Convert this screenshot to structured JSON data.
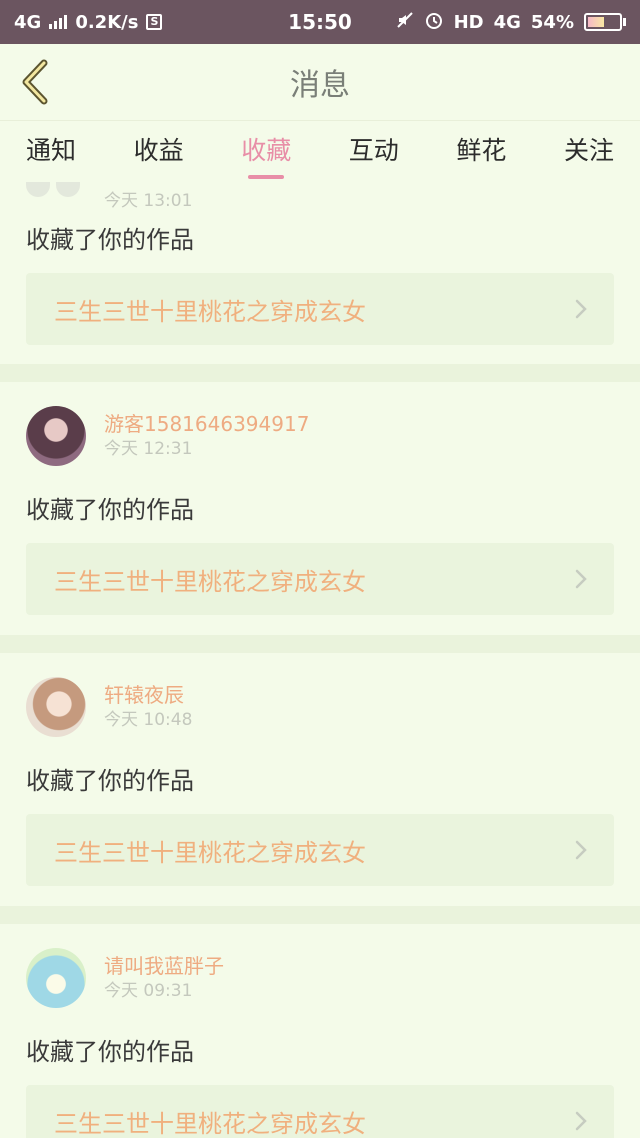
{
  "status_bar": {
    "network": "4G",
    "speed": "0.2K/s",
    "s_icon": "S",
    "time": "15:50",
    "hd": "HD",
    "net_right": "4G",
    "battery": "54%"
  },
  "header": {
    "title": "消息"
  },
  "tabs": [
    {
      "label": "通知"
    },
    {
      "label": "收益"
    },
    {
      "label": "收藏",
      "active": true
    },
    {
      "label": "互动"
    },
    {
      "label": "鲜花"
    },
    {
      "label": "关注"
    }
  ],
  "messages": [
    {
      "username": "",
      "time": "今天 13:01",
      "action": "收藏了你的作品",
      "work_title": "三生三世十里桃花之穿成玄女"
    },
    {
      "username": "游客1581646394917",
      "time": "今天 12:31",
      "action": "收藏了你的作品",
      "work_title": "三生三世十里桃花之穿成玄女"
    },
    {
      "username": "轩辕夜辰",
      "time": "今天 10:48",
      "action": "收藏了你的作品",
      "work_title": "三生三世十里桃花之穿成玄女"
    },
    {
      "username": "请叫我蓝胖子",
      "time": "今天 09:31",
      "action": "收藏了你的作品",
      "work_title": "三生三世十里桃花之穿成玄女"
    }
  ],
  "colors": {
    "accent": "#e88ea7",
    "username": "#eeab82",
    "work_title": "#f0b07e",
    "background": "#f4fbe9"
  }
}
